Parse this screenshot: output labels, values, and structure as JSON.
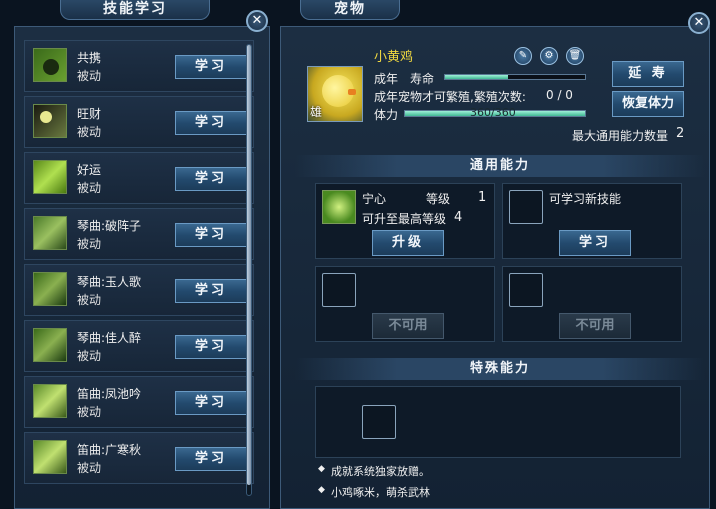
{
  "left_panel": {
    "title": "技能学习",
    "skills": [
      {
        "name": "共携",
        "type": "被动",
        "button": "学习",
        "icon": "money-bag-icon"
      },
      {
        "name": "旺财",
        "type": "被动",
        "button": "学习",
        "icon": "moon-icon"
      },
      {
        "name": "好运",
        "type": "被动",
        "button": "学习",
        "icon": "luck-icon"
      },
      {
        "name": "琴曲:破阵子",
        "type": "被动",
        "button": "学习",
        "icon": "zither-icon"
      },
      {
        "name": "琴曲:玉人歌",
        "type": "被动",
        "button": "学习",
        "icon": "zither-icon"
      },
      {
        "name": "琴曲:佳人醉",
        "type": "被动",
        "button": "学习",
        "icon": "zither-icon"
      },
      {
        "name": "笛曲:凤池吟",
        "type": "被动",
        "button": "学习",
        "icon": "flute-icon"
      },
      {
        "name": "笛曲:广寒秋",
        "type": "被动",
        "button": "学习",
        "icon": "flute-icon"
      }
    ]
  },
  "right_panel": {
    "title": "宠物",
    "pet": {
      "name": "小黄鸡",
      "gender": "雄",
      "stage": "成年",
      "lifespan_label": "寿命",
      "lifespan_fraction": 0.45,
      "breed_text": "成年宠物才可繁殖,繁殖次数:",
      "breed_count": "0 / 0",
      "stamina_label": "体力",
      "stamina_value": "360/360",
      "stamina_fraction": 1.0,
      "max_abilities_label": "最大通用能力数量",
      "max_abilities": "2"
    },
    "buttons": {
      "extend": "延 寿",
      "restore": "恢复体力"
    },
    "general_section": {
      "title": "通用能力",
      "slot1": {
        "name": "宁心",
        "level_label": "等级",
        "level": "1",
        "max_label": "可升至最高等级",
        "max_level": "4",
        "button": "升级"
      },
      "slot2": {
        "text": "可学习新技能",
        "button": "学习"
      },
      "slot3": {
        "button": "不可用"
      },
      "slot4": {
        "button": "不可用"
      }
    },
    "special_section": {
      "title": "特殊能力",
      "notes": [
        "成就系统独家放赠。",
        "小鸡啄米，萌杀武林"
      ]
    }
  }
}
